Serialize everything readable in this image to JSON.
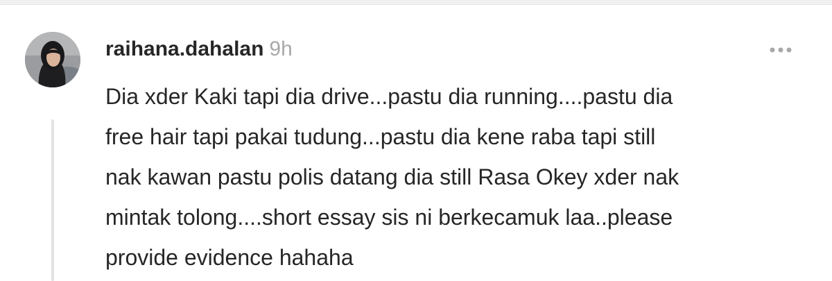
{
  "comment": {
    "avatar_icon": "user-avatar-photo",
    "username": "raihana.dahalan",
    "timestamp": "9h",
    "more_icon": "more-options-icon",
    "text_lines": [
      "Dia xder Kaki tapi dia drive...pastu dia running....pastu dia",
      "free hair tapi pakai tudung...pastu dia kene raba tapi still",
      "nak kawan pastu polis datang dia still Rasa Okey xder nak",
      "mintak tolong....short essay sis ni berkecamuk laa..please",
      "provide evidence hahaha"
    ]
  },
  "colors": {
    "text": "#262626",
    "muted": "#a8a8a8",
    "thread_line": "#e3e3e3"
  }
}
